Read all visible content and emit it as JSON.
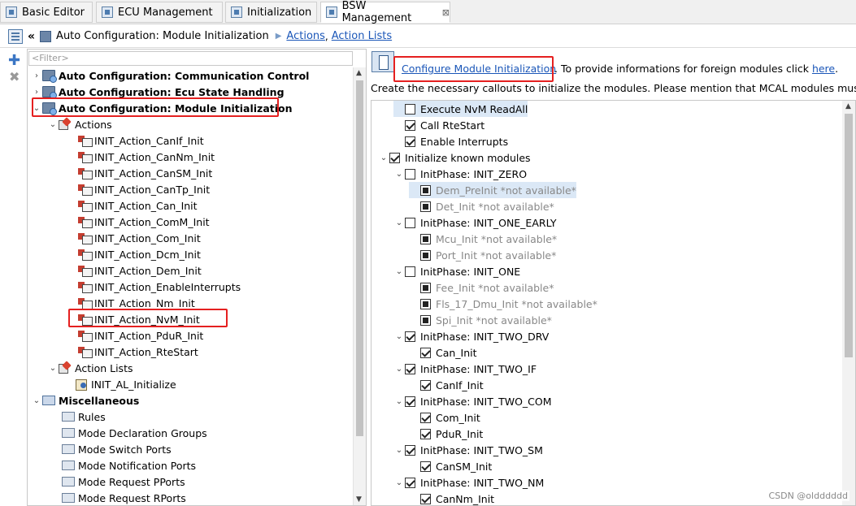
{
  "tabs": [
    {
      "label": "Basic Editor"
    },
    {
      "label": "ECU Management"
    },
    {
      "label": "Initialization"
    },
    {
      "label": "BSW Management",
      "close": "⊠"
    }
  ],
  "breadcrumb": {
    "title": "Auto Configuration: Module Initialization",
    "link_actions": "Actions",
    "comma": ",",
    "link_action_lists": "Action Lists"
  },
  "filter": {
    "placeholder": "<Filter>"
  },
  "tree": {
    "communication_control": "Auto Configuration: Communication Control",
    "ecu_state_handling": "Auto Configuration: Ecu State Handling",
    "module_initialization": "Auto Configuration: Module Initialization",
    "actions": "Actions",
    "action_items": [
      "INIT_Action_CanIf_Init",
      "INIT_Action_CanNm_Init",
      "INIT_Action_CanSM_Init",
      "INIT_Action_CanTp_Init",
      "INIT_Action_Can_Init",
      "INIT_Action_ComM_Init",
      "INIT_Action_Com_Init",
      "INIT_Action_Dcm_Init",
      "INIT_Action_Dem_Init",
      "INIT_Action_EnableInterrupts",
      "INIT_Action_Nm_Init",
      "INIT_Action_NvM_Init",
      "INIT_Action_PduR_Init",
      "INIT_Action_RteStart"
    ],
    "action_lists": "Action Lists",
    "action_list_item": "INIT_AL_Initialize",
    "miscellaneous": "Miscellaneous",
    "misc_items": [
      "Rules",
      "Mode Declaration Groups",
      "Mode Switch Ports",
      "Mode Notification Ports",
      "Mode Request PPorts",
      "Mode Request RPorts"
    ]
  },
  "right": {
    "configure_link": "Configure Module Initialization",
    "foreign_text": ". To provide informations for foreign modules click",
    "here_link": "here",
    "period": ".",
    "description": "Create the necessary callouts to initialize the modules. Please mention that MCAL modules must be init",
    "items": [
      {
        "label": "Execute NvM ReadAll",
        "check": "empty",
        "twisty": ""
      },
      {
        "label": "Call RteStart",
        "check": "checked",
        "twisty": ""
      },
      {
        "label": "Enable Interrupts",
        "check": "checked",
        "twisty": ""
      },
      {
        "label": "Initialize known modules",
        "check": "checked",
        "twisty": "⌄"
      },
      {
        "label": "InitPhase: INIT_ZERO",
        "check": "empty",
        "twisty": "⌄"
      },
      {
        "label": "Dem_PreInit *not available*",
        "check": "filled",
        "twisty": ""
      },
      {
        "label": "Det_Init *not available*",
        "check": "filled",
        "twisty": ""
      },
      {
        "label": "InitPhase: INIT_ONE_EARLY",
        "check": "empty",
        "twisty": "⌄"
      },
      {
        "label": "Mcu_Init *not available*",
        "check": "filled",
        "twisty": ""
      },
      {
        "label": "Port_Init *not available*",
        "check": "filled",
        "twisty": ""
      },
      {
        "label": "InitPhase: INIT_ONE",
        "check": "empty",
        "twisty": "⌄"
      },
      {
        "label": "Fee_Init *not available*",
        "check": "filled",
        "twisty": ""
      },
      {
        "label": "Fls_17_Dmu_Init *not available*",
        "check": "filled",
        "twisty": ""
      },
      {
        "label": "Spi_Init *not available*",
        "check": "filled",
        "twisty": ""
      },
      {
        "label": "InitPhase: INIT_TWO_DRV",
        "check": "checked",
        "twisty": "⌄"
      },
      {
        "label": "Can_Init",
        "check": "checked",
        "twisty": ""
      },
      {
        "label": "InitPhase: INIT_TWO_IF",
        "check": "checked",
        "twisty": "⌄"
      },
      {
        "label": "CanIf_Init",
        "check": "checked",
        "twisty": ""
      },
      {
        "label": "InitPhase: INIT_TWO_COM",
        "check": "checked",
        "twisty": "⌄"
      },
      {
        "label": "Com_Init",
        "check": "checked",
        "twisty": ""
      },
      {
        "label": "PduR_Init",
        "check": "checked",
        "twisty": ""
      },
      {
        "label": "InitPhase: INIT_TWO_SM",
        "check": "checked",
        "twisty": "⌄"
      },
      {
        "label": "CanSM_Init",
        "check": "checked",
        "twisty": ""
      },
      {
        "label": "InitPhase: INIT_TWO_NM",
        "check": "checked",
        "twisty": "⌄"
      },
      {
        "label": "CanNm_Init",
        "check": "checked",
        "twisty": ""
      }
    ]
  },
  "watermark": "CSDN @oldddddd",
  "colors": {
    "highlight": "#e52020",
    "link": "#1a56b8"
  }
}
